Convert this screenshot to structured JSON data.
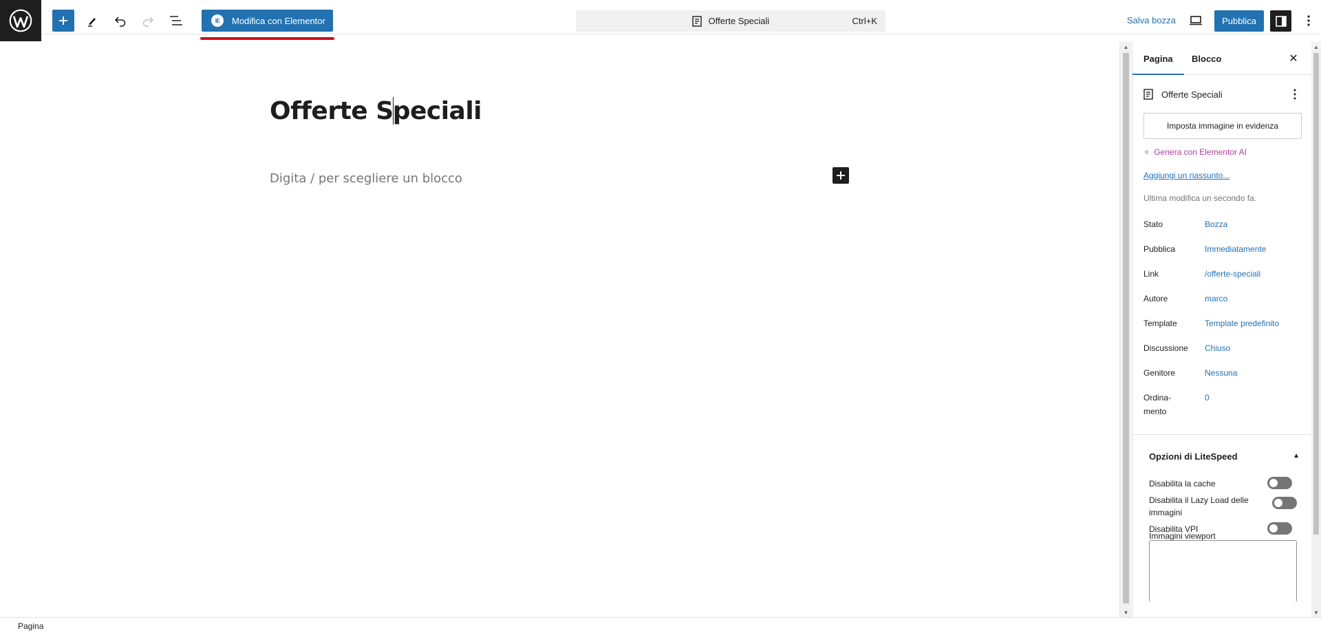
{
  "toolbar": {
    "elementor_label": "Modifica con Elementor",
    "elementor_icon_text": "IE",
    "command_title": "Offerte Speciali",
    "command_shortcut": "Ctrl+K",
    "save_draft_label": "Salva bozza",
    "publish_label": "Pubblica",
    "icons": [
      "wordpress-logo",
      "add-block-icon",
      "tools-pen-icon",
      "undo-icon",
      "redo-icon",
      "document-overview-icon",
      "document-icon",
      "preview-desktop-icon",
      "settings-sidebar-icon",
      "more-options-icon"
    ]
  },
  "editor": {
    "title_before_caret": "Offerte S",
    "title_after_caret": "peciali",
    "placeholder": "Digita / per scegliere un blocco"
  },
  "sidebar": {
    "tabs": [
      {
        "label": "Pagina",
        "active": true
      },
      {
        "label": "Blocco",
        "active": false
      }
    ],
    "document_title": "Offerte Speciali",
    "featured_image_label": "Imposta immagine in evidenza",
    "ai_link": "Genera con Elementor AI",
    "excerpt_link": "Aggiungi un riassunto...",
    "last_modified": "Ultima modifica un secondo fa.",
    "meta": [
      {
        "label": "Stato",
        "value": "Bozza"
      },
      {
        "label": "Pubblica",
        "value": "Immediatamente"
      },
      {
        "label": "Link",
        "value": "/offerte-speciali"
      },
      {
        "label": "Autore",
        "value": "marco"
      },
      {
        "label": "Template",
        "value": "Template predefinito"
      },
      {
        "label": "Discussione",
        "value": "Chiuso"
      },
      {
        "label": "Genitore",
        "value": "Nessuna"
      },
      {
        "label": "Ordina-\nmento",
        "value": "0"
      }
    ],
    "litespeed": {
      "title": "Opzioni di LiteSpeed",
      "options": [
        {
          "label": "Disabilita la cache",
          "enabled": false
        },
        {
          "label": "Disabilita il Lazy Load delle immagini",
          "enabled": false
        },
        {
          "label": "Disabilita VPI",
          "enabled": false
        }
      ],
      "viewport_label": "Immagini viewport",
      "viewport_value": ""
    }
  },
  "footer": {
    "breadcrumb": "Pagina"
  },
  "colors": {
    "accent": "#2271b1",
    "dark": "#1e1e1e",
    "ai": "#b03da6",
    "underline": "#d10d1f"
  }
}
